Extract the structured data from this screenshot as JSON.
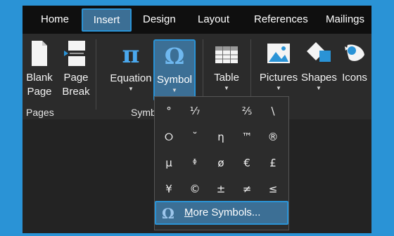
{
  "tabs": {
    "home": "Home",
    "insert": "Insert",
    "design": "Design",
    "layout": "Layout",
    "references": "References",
    "mailings": "Mailings"
  },
  "ribbon": {
    "blank_page": [
      "Blank",
      "Page"
    ],
    "page_break": [
      "Page",
      "Break"
    ],
    "pages_group": "Pages",
    "equation": "Equation",
    "symbol": "Symbol",
    "symbols_group": "Symb",
    "table": "Table",
    "pictures": "Pictures",
    "shapes": "Shapes",
    "icons": "Icons",
    "pi_glyph": "π",
    "omega_glyph": "Ω"
  },
  "symbols": [
    [
      "°",
      "⅐",
      "",
      "⅖",
      "\\"
    ],
    [
      "⭘",
      "˘",
      "η",
      "™",
      "®"
    ],
    [
      "µ",
      "ᶲ",
      "ø",
      "€",
      "£"
    ],
    [
      "¥",
      "©",
      "±",
      "≠",
      "≤"
    ]
  ],
  "more_symbols": {
    "icon": "Ω",
    "label_first": "M",
    "label_rest": "ore Symbols..."
  },
  "colors": {
    "accent": "#2a93d6",
    "selected_fill": "#3c6f95",
    "tabbar_bg": "#0f0f0f",
    "ribbon_bg": "#2b2b2b"
  }
}
